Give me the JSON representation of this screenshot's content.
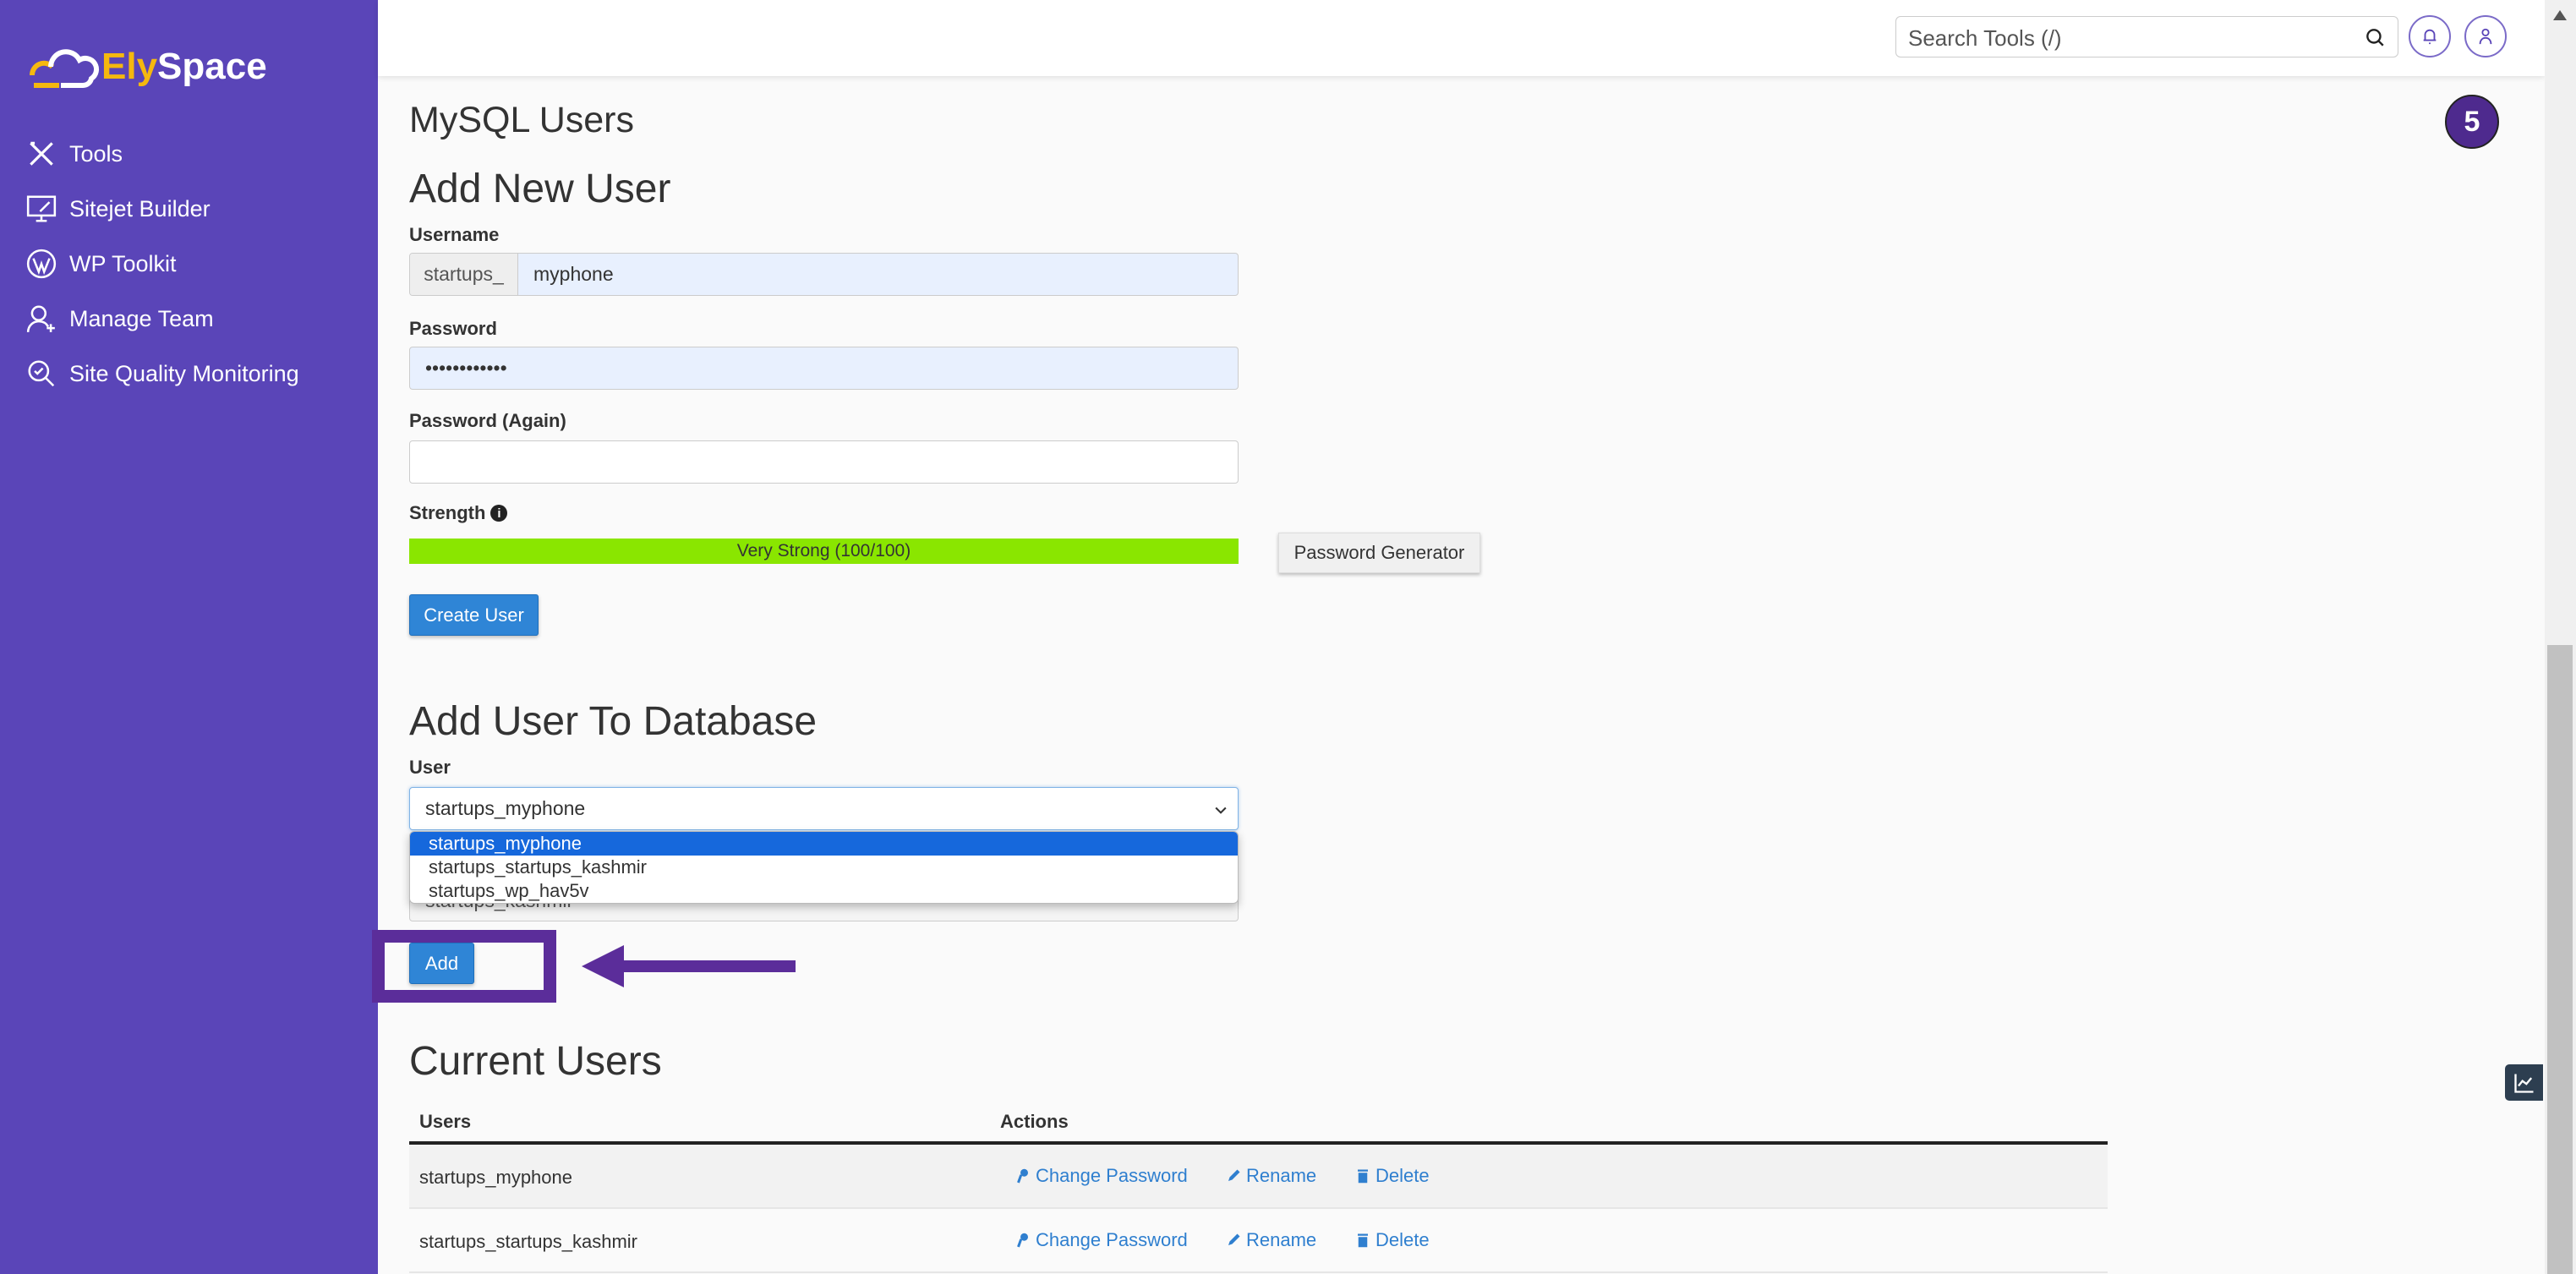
{
  "brand": {
    "name_part1": "Ely",
    "name_part2": "Space",
    "accent": "#f5b80f",
    "sidebar_color": "#5a45b8"
  },
  "sidebar": {
    "items": [
      {
        "label": "Tools",
        "icon": "tools-icon"
      },
      {
        "label": "Sitejet Builder",
        "icon": "monitor-pen-icon"
      },
      {
        "label": "WP Toolkit",
        "icon": "wordpress-icon"
      },
      {
        "label": "Manage Team",
        "icon": "user-add-icon"
      },
      {
        "label": "Site Quality Monitoring",
        "icon": "search-check-icon"
      }
    ]
  },
  "header": {
    "search_placeholder": "Search Tools (/)"
  },
  "page": {
    "title": "MySQL Users",
    "step_badge": "5"
  },
  "add_user": {
    "heading": "Add New User",
    "username_label": "Username",
    "username_prefix": "startups_",
    "username_value": "myphone",
    "password_label": "Password",
    "password_value": "••••••••••••",
    "password_again_label": "Password (Again)",
    "password_again_value": "",
    "strength_label": "Strength",
    "strength_text": "Very Strong (100/100)",
    "strength_percent": 100,
    "strength_color": "#8ae600",
    "password_generator": "Password Generator",
    "create_button": "Create User"
  },
  "add_to_db": {
    "heading": "Add User To Database",
    "user_label": "User",
    "user_selected": "startups_myphone",
    "user_options": [
      "startups_myphone",
      "startups_startups_kashmir",
      "startups_wp_hav5v"
    ],
    "database_selected": "startups_kashmir",
    "add_button": "Add"
  },
  "current_users": {
    "heading": "Current Users",
    "columns": [
      "Users",
      "Actions"
    ],
    "rows": [
      {
        "user": "startups_myphone"
      },
      {
        "user": "startups_startups_kashmir"
      }
    ],
    "actions": {
      "change_password": "Change Password",
      "rename": "Rename",
      "delete": "Delete"
    }
  },
  "annotation_color": "#5b2d9a"
}
